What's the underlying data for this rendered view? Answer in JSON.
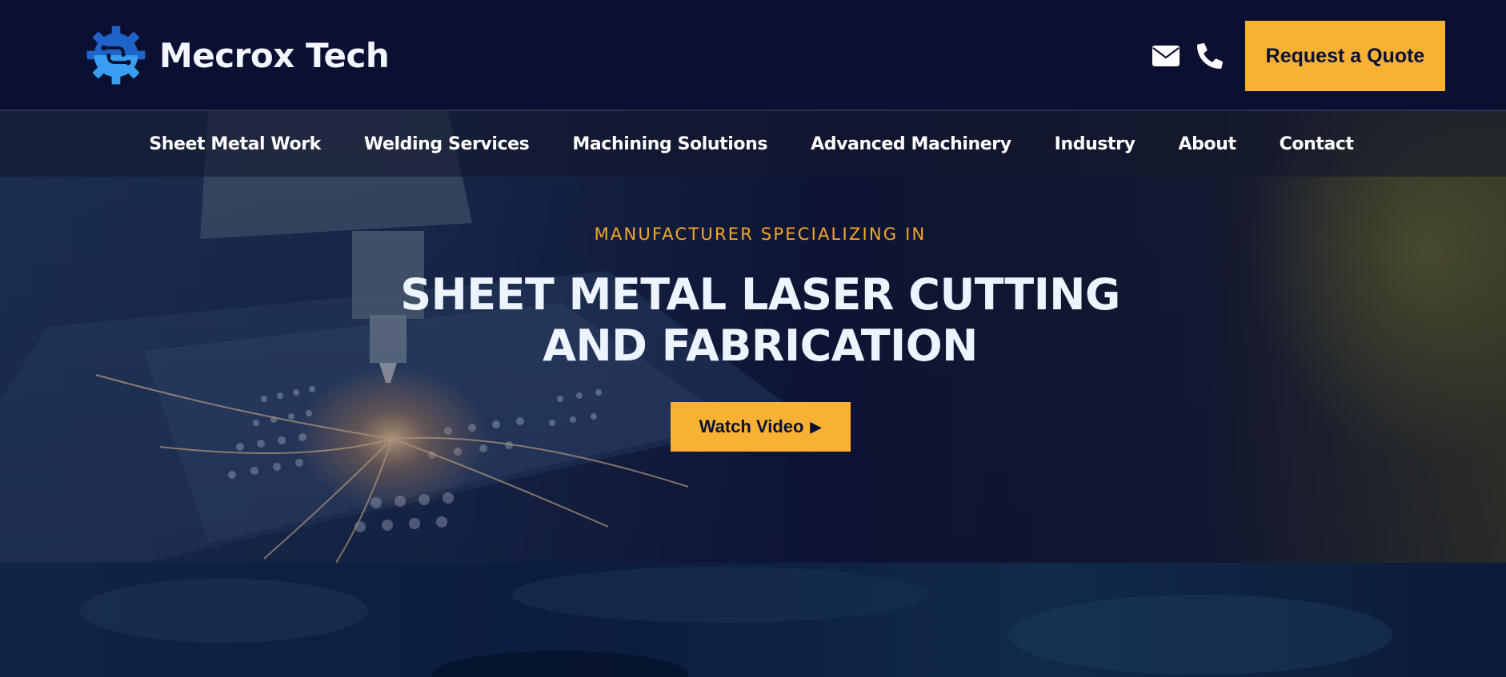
{
  "header": {
    "brand_name": "Mecrox Tech",
    "logo_icon": "gear-circuit-logo-icon",
    "icons": [
      "envelope-icon",
      "phone-icon"
    ],
    "quote_button": "Request a Quote"
  },
  "nav": {
    "items": [
      {
        "label": "Sheet Metal Work"
      },
      {
        "label": "Welding Services"
      },
      {
        "label": "Machining Solutions"
      },
      {
        "label": "Advanced Machinery"
      },
      {
        "label": "Industry"
      },
      {
        "label": "About"
      },
      {
        "label": "Contact"
      }
    ]
  },
  "hero": {
    "eyebrow": "MANUFACTURER SPECIALIZING IN",
    "title_line1": "SHEET METAL LASER CUTTING",
    "title_line2": "AND FABRICATION",
    "watch_button": "Watch Video",
    "play_icon": "play-icon"
  },
  "colors": {
    "header_bg": "#0b1033",
    "accent": "#f8b133",
    "eyebrow": "#f5a82a",
    "text_light": "#eef4ff",
    "logo_dark": "#1e63c8",
    "logo_light": "#3a9ef0"
  }
}
